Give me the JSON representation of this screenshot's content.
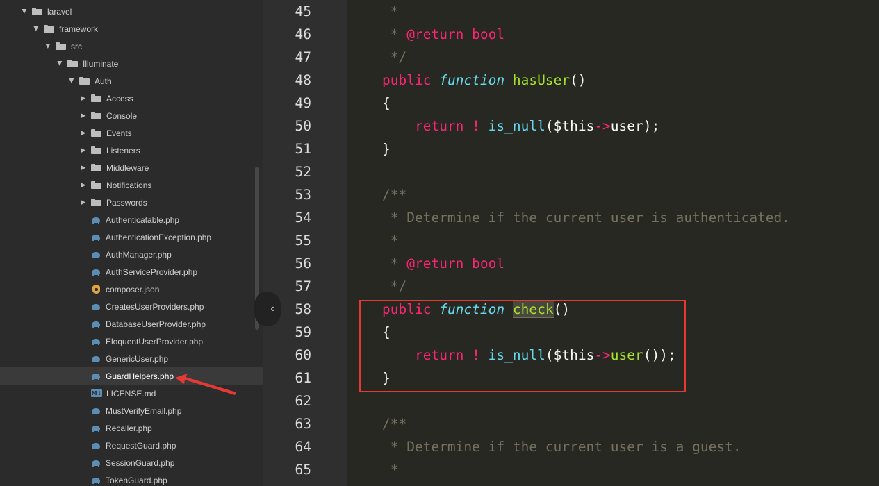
{
  "sidebar": {
    "folders": [
      "laravel",
      "framework",
      "src",
      "Illuminate",
      "Auth",
      "Access",
      "Console",
      "Events",
      "Listeners",
      "Middleware",
      "Notifications",
      "Passwords"
    ],
    "files": [
      "Authenticatable.php",
      "AuthenticationException.php",
      "AuthManager.php",
      "AuthServiceProvider.php",
      "composer.json",
      "CreatesUserProviders.php",
      "DatabaseUserProvider.php",
      "EloquentUserProvider.php",
      "GenericUser.php",
      "GuardHelpers.php",
      "LICENSE.md",
      "MustVerifyEmail.php",
      "Recaller.php",
      "RequestGuard.php",
      "SessionGuard.php",
      "TokenGuard.php"
    ],
    "selected_file": "GuardHelpers.php",
    "collapse_glyph": "‹"
  },
  "editor": {
    "line_numbers": [
      "45",
      "46",
      "47",
      "48",
      "49",
      "50",
      "51",
      "52",
      "53",
      "54",
      "55",
      "56",
      "57",
      "58",
      "59",
      "60",
      "61",
      "62",
      "63",
      "64",
      "65"
    ],
    "tokens": {
      "star": " *",
      "return_tag": "@return bool",
      "close_comment": " */",
      "open_comment": "/**",
      "public": "public",
      "function": "function",
      "has_user": "hasUser",
      "check": "check",
      "parens": "()",
      "brace_open": "{",
      "brace_close": "}",
      "return": "return",
      "not": "!",
      "is_null": "is_null",
      "paren_open": "(",
      "this": "$this",
      "arrow": "->",
      "user": "user",
      "tail_50": ");",
      "tail_60": "());",
      "doc_check": "Determine if the current user is authenticated.",
      "doc_guest": "Determine if the current user is a guest."
    }
  },
  "colors": {
    "background": "#272822",
    "sidebar": "#2b2b2b",
    "keyword": "#f92672",
    "storage": "#66d9ef",
    "entity": "#a6e22e",
    "comment": "#75715e",
    "annotation": "#e53935"
  },
  "icons": [
    "folder-icon",
    "php-file-icon",
    "json-file-icon",
    "markdown-file-icon",
    "chevron-right-icon",
    "chevron-down-icon",
    "chevron-left-icon"
  ]
}
